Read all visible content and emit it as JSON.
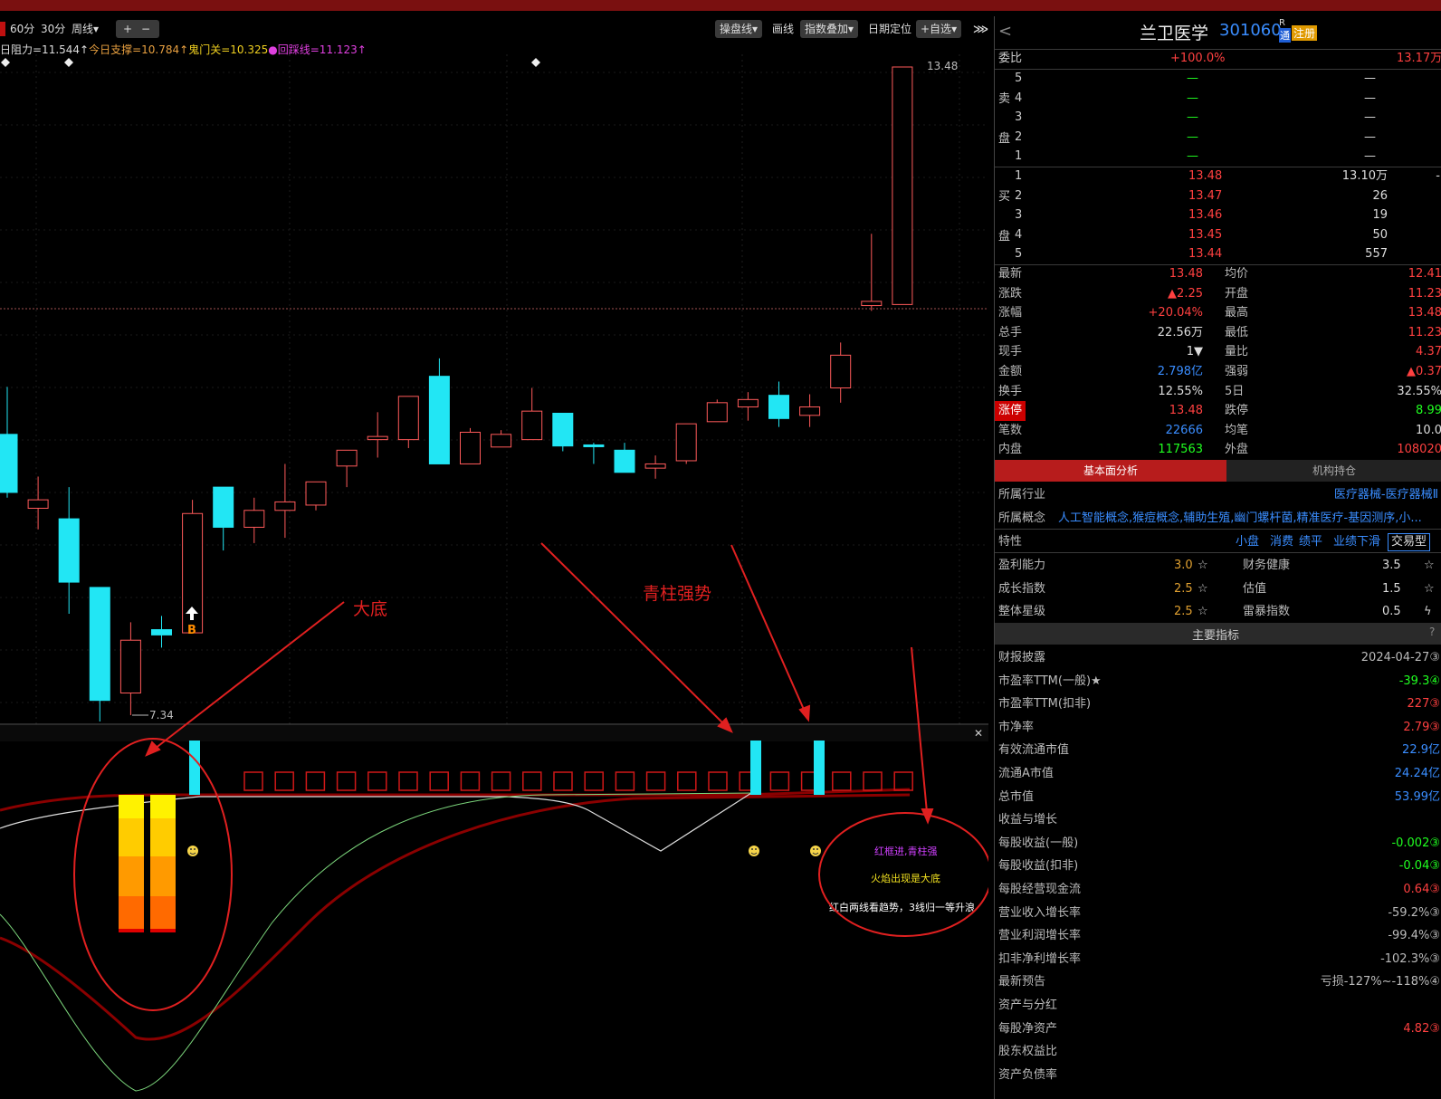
{
  "toolbar": {
    "periods": [
      "60分",
      "30分",
      "周线"
    ],
    "plus": "+",
    "minus": "−",
    "buttons": [
      "操盘线",
      "画线",
      "指数叠加",
      "日期定位",
      "+自选"
    ],
    "dropdown_chevron": "▾",
    "collapse": "⋙"
  },
  "levels": {
    "resist": "日阻力=11.544↑",
    "support": "今日支撑=10.784↑",
    "gate": "鬼门关=10.325",
    "dot": "●",
    "step": "回踩线=11.123↑"
  },
  "chart": {
    "high_label": "13.48",
    "low_label": "7.34",
    "buy_marker": "B",
    "annot_bottom": "大底",
    "annot_blue": "青柱强势",
    "legend": [
      "红框进,青柱强",
      "火焰出现是大底",
      "红白两线看趋势，3线归一等升浪"
    ],
    "close_x": "✕",
    "candles": [
      {
        "o": 10.0,
        "c": 9.45,
        "h": 10.45,
        "l": 9.4,
        "t": "down"
      },
      {
        "o": 9.3,
        "c": 9.38,
        "h": 9.6,
        "l": 9.1,
        "t": "up"
      },
      {
        "o": 9.2,
        "c": 8.6,
        "h": 9.5,
        "l": 8.3,
        "t": "down"
      },
      {
        "o": 8.55,
        "c": 7.48,
        "h": 8.55,
        "l": 7.28,
        "t": "down"
      },
      {
        "o": 7.55,
        "c": 8.05,
        "h": 8.22,
        "l": 7.34,
        "t": "up"
      },
      {
        "o": 8.15,
        "c": 8.1,
        "h": 8.28,
        "l": 7.98,
        "t": "down"
      },
      {
        "o": 8.12,
        "c": 9.25,
        "h": 9.38,
        "l": 8.12,
        "t": "up"
      },
      {
        "o": 9.5,
        "c": 9.12,
        "h": 9.5,
        "l": 8.9,
        "t": "down"
      },
      {
        "o": 9.12,
        "c": 9.28,
        "h": 9.4,
        "l": 8.97,
        "t": "up"
      },
      {
        "o": 9.28,
        "c": 9.36,
        "h": 9.72,
        "l": 9.02,
        "t": "up"
      },
      {
        "o": 9.33,
        "c": 9.55,
        "h": 9.55,
        "l": 9.28,
        "t": "up"
      },
      {
        "o": 9.7,
        "c": 9.85,
        "h": 9.85,
        "l": 9.5,
        "t": "up"
      },
      {
        "o": 9.95,
        "c": 9.98,
        "h": 10.21,
        "l": 9.78,
        "t": "up"
      },
      {
        "o": 9.95,
        "c": 10.36,
        "h": 10.36,
        "l": 9.87,
        "t": "up"
      },
      {
        "o": 10.55,
        "c": 9.72,
        "h": 10.72,
        "l": 9.72,
        "t": "down"
      },
      {
        "o": 9.72,
        "c": 10.02,
        "h": 10.06,
        "l": 9.72,
        "t": "up"
      },
      {
        "o": 9.88,
        "c": 10.0,
        "h": 10.04,
        "l": 9.88,
        "t": "up"
      },
      {
        "o": 9.95,
        "c": 10.22,
        "h": 10.44,
        "l": 9.95,
        "t": "up"
      },
      {
        "o": 10.2,
        "c": 9.89,
        "h": 10.2,
        "l": 9.84,
        "t": "down"
      },
      {
        "o": 9.9,
        "c": 9.89,
        "h": 9.92,
        "l": 9.72,
        "t": "down"
      },
      {
        "o": 9.85,
        "c": 9.64,
        "h": 9.92,
        "l": 9.64,
        "t": "down"
      },
      {
        "o": 9.68,
        "c": 9.72,
        "h": 9.8,
        "l": 9.58,
        "t": "up"
      },
      {
        "o": 9.75,
        "c": 10.1,
        "h": 10.1,
        "l": 9.72,
        "t": "up"
      },
      {
        "o": 10.12,
        "c": 10.3,
        "h": 10.33,
        "l": 10.12,
        "t": "up"
      },
      {
        "o": 10.26,
        "c": 10.33,
        "h": 10.4,
        "l": 10.13,
        "t": "up"
      },
      {
        "o": 10.37,
        "c": 10.15,
        "h": 10.5,
        "l": 10.07,
        "t": "down"
      },
      {
        "o": 10.18,
        "c": 10.26,
        "h": 10.38,
        "l": 10.07,
        "t": "up"
      },
      {
        "o": 10.44,
        "c": 10.75,
        "h": 10.87,
        "l": 10.3,
        "t": "up"
      },
      {
        "o": 11.22,
        "c": 11.26,
        "h": 11.9,
        "l": 11.17,
        "t": "up"
      },
      {
        "o": 11.23,
        "c": 13.48,
        "h": 13.48,
        "l": 11.23,
        "t": "up"
      }
    ]
  },
  "quote": {
    "back": "<",
    "name": "兰卫医学",
    "code": "301060",
    "r_mark": "R",
    "tong": "通",
    "reg": "注册",
    "weibi_label": "委比",
    "weibi_value": "+100.0%",
    "weibi_right": "13.17万",
    "sell_side": [
      "卖",
      "盘"
    ],
    "buy_side": [
      "买",
      "盘"
    ],
    "sell": [
      {
        "n": "5",
        "p": "—",
        "v": "—"
      },
      {
        "n": "4",
        "p": "—",
        "v": "—"
      },
      {
        "n": "3",
        "p": "—",
        "v": "—"
      },
      {
        "n": "2",
        "p": "—",
        "v": "—"
      },
      {
        "n": "1",
        "p": "—",
        "v": "—"
      }
    ],
    "buy": [
      {
        "n": "1",
        "p": "13.48",
        "v": "13.10万",
        "x": "-"
      },
      {
        "n": "2",
        "p": "13.47",
        "v": "26"
      },
      {
        "n": "3",
        "p": "13.46",
        "v": "19"
      },
      {
        "n": "4",
        "p": "13.45",
        "v": "50"
      },
      {
        "n": "5",
        "p": "13.44",
        "v": "557"
      }
    ],
    "stats": [
      {
        "l1": "最新",
        "v1": "13.48",
        "c1": "red",
        "l2": "均价",
        "v2": "12.41",
        "c2": "red"
      },
      {
        "l1": "涨跌",
        "v1": "▲2.25",
        "c1": "red",
        "l2": "开盘",
        "v2": "11.23",
        "c2": "red"
      },
      {
        "l1": "涨幅",
        "v1": "+20.04%",
        "c1": "red",
        "l2": "最高",
        "v2": "13.48",
        "c2": "red"
      },
      {
        "l1": "总手",
        "v1": "22.56万",
        "c1": "white",
        "l2": "最低",
        "v2": "11.23",
        "c2": "red"
      },
      {
        "l1": "现手",
        "v1": "1▼",
        "c1": "white",
        "l2": "量比",
        "v2": "4.37",
        "c2": "red"
      },
      {
        "l1": "金额",
        "v1": "2.798亿",
        "c1": "blue",
        "l2": "强弱",
        "v2": "▲0.37",
        "c2": "red"
      },
      {
        "l1": "换手",
        "v1": "12.55%",
        "c1": "white",
        "l2": "5日",
        "v2": "32.55%",
        "c2": "white"
      },
      {
        "l1": "涨停",
        "v1": "13.48",
        "c1": "red",
        "l2": "跌停",
        "v2": "8.99",
        "c2": "green"
      },
      {
        "l1": "笔数",
        "v1": "22666",
        "c1": "blue",
        "l2": "均笔",
        "v2": "10.0",
        "c2": "white"
      },
      {
        "l1": "内盘",
        "v1": "117563",
        "c1": "green",
        "l2": "外盘",
        "v2": "108020",
        "c2": "red"
      }
    ]
  },
  "fund": {
    "tabs": [
      "基本面分析",
      "机构持仓"
    ],
    "industry_label": "所属行业",
    "industry": "医疗器械-医疗器械Ⅱ",
    "concept_label": "所属概念",
    "concept": "人工智能概念,猴痘概念,辅助生殖,幽门螺杆菌,精准医疗-基因测序,小...",
    "feature_label": "特性",
    "features": [
      "小盘",
      "消费",
      "绩平",
      "业绩下滑"
    ],
    "feature_box": "交易型",
    "ratings": [
      {
        "l1": "盈利能力",
        "v1": "3.0",
        "i1": "☆",
        "l2": "财务健康",
        "v2": "3.5",
        "i2": "☆"
      },
      {
        "l1": "成长指数",
        "v1": "2.5",
        "i1": "☆",
        "l2": "估值",
        "v2": "1.5",
        "i2": "☆"
      },
      {
        "l1": "整体星级",
        "v1": "2.5",
        "i1": "☆",
        "l2": "雷暴指数",
        "v2": "0.5",
        "i2": "ϟ"
      }
    ],
    "key_header": "主要指标",
    "key_q": "?",
    "metrics": [
      {
        "l": "财报披露",
        "v": "2024-04-27③",
        "c": "gray"
      },
      {
        "l": "市盈率TTM(一般)★",
        "v": "-39.3④",
        "c": "green"
      },
      {
        "l": "市盈率TTM(扣非)",
        "v": "227③",
        "c": "red"
      },
      {
        "l": "市净率",
        "v": "2.79③",
        "c": "red"
      },
      {
        "l": "有效流通市值",
        "v": "22.9亿",
        "c": "blue"
      },
      {
        "l": "流通A市值",
        "v": "24.24亿",
        "c": "blue"
      },
      {
        "l": "总市值",
        "v": "53.99亿",
        "c": "blue"
      },
      {
        "l": "收益与增长",
        "v": "",
        "c": "gray"
      },
      {
        "l": "每股收益(一般)",
        "v": "-0.002③",
        "c": "green"
      },
      {
        "l": "每股收益(扣非)",
        "v": "-0.04③",
        "c": "green"
      },
      {
        "l": "每股经营现金流",
        "v": "0.64③",
        "c": "red"
      },
      {
        "l": "营业收入增长率",
        "v": "-59.2%③",
        "c": "gray"
      },
      {
        "l": "营业利润增长率",
        "v": "-99.4%③",
        "c": "gray"
      },
      {
        "l": "扣非净利增长率",
        "v": "-102.3%③",
        "c": "gray"
      },
      {
        "l": "最新预告",
        "v": "亏损-127%~-118%④",
        "c": "gray"
      },
      {
        "l": "资产与分红",
        "v": "",
        "c": "gray"
      },
      {
        "l": "每股净资产",
        "v": "4.82③",
        "c": "red"
      },
      {
        "l": "股东权益比",
        "v": "",
        "c": "gray"
      },
      {
        "l": "资产负债率",
        "v": "",
        "c": "gray"
      }
    ]
  }
}
